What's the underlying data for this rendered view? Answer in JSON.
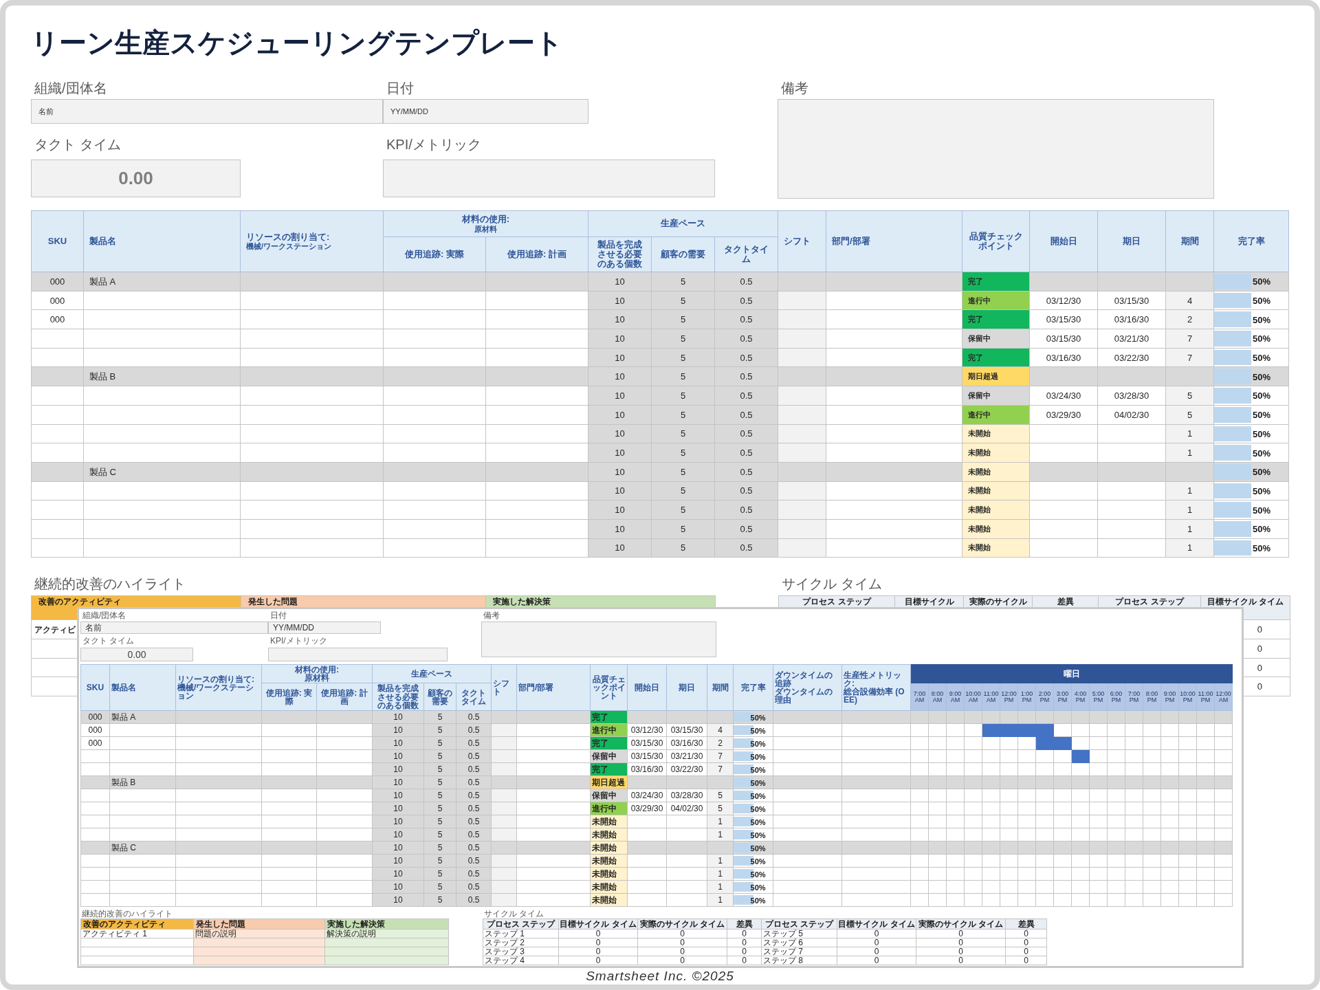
{
  "title": "リーン生産スケジューリングテンプレート",
  "form": {
    "org_label": "組織/団体名",
    "org_value": "名前",
    "date_label": "日付",
    "date_value": "YY/MM/DD",
    "notes_label": "備考",
    "takt_label": "タクト タイム",
    "takt_value": "0.00",
    "kpi_label": "KPI/メトリック"
  },
  "schedule": {
    "columns": [
      {
        "kind": "single",
        "title": "SKU"
      },
      {
        "kind": "single",
        "title": "製品名"
      },
      {
        "kind": "single",
        "title": "リソースの割り当て:",
        "subtitle": "機械/ワークステーション"
      },
      {
        "kind": "group",
        "title": "材料の使用:",
        "subtitle": "原材料",
        "children": [
          "使用追跡: 実際",
          "使用追跡: 計画"
        ]
      },
      {
        "kind": "group",
        "title": "生産ペース",
        "children": [
          "製品を完成させる必要のある個数",
          "顧客の需要",
          "タクトタイム"
        ]
      },
      {
        "kind": "single",
        "title": "シフト"
      },
      {
        "kind": "single",
        "title": "部門/部署"
      },
      {
        "kind": "single",
        "title": "品質チェックポイント"
      },
      {
        "kind": "single",
        "title": "開始日"
      },
      {
        "kind": "single",
        "title": "期日"
      },
      {
        "kind": "single",
        "title": "期間"
      },
      {
        "kind": "single",
        "title": "完了率"
      }
    ],
    "rows": [
      {
        "group": true,
        "sku": "000",
        "product": "製品 A",
        "produce": "10",
        "demand": "5",
        "takt": "0.5",
        "status": {
          "label": "完了",
          "kind": "done"
        },
        "completion": "50%",
        "level": 0.5
      },
      {
        "group": false,
        "sku": "000",
        "produce": "10",
        "demand": "5",
        "takt": "0.5",
        "status": {
          "label": "進行中",
          "kind": "progress"
        },
        "start": "03/12/30",
        "due": "03/15/30",
        "duration": "4",
        "completion": "50%",
        "level": 0.5
      },
      {
        "group": false,
        "sku": "000",
        "produce": "10",
        "demand": "5",
        "takt": "0.5",
        "status": {
          "label": "完了",
          "kind": "done"
        },
        "start": "03/15/30",
        "due": "03/16/30",
        "duration": "2",
        "completion": "50%",
        "level": 0.5
      },
      {
        "group": false,
        "produce": "10",
        "demand": "5",
        "takt": "0.5",
        "status": {
          "label": "保留中",
          "kind": "hold"
        },
        "start": "03/15/30",
        "due": "03/21/30",
        "duration": "7",
        "completion": "50%",
        "level": 0.5
      },
      {
        "group": false,
        "produce": "10",
        "demand": "5",
        "takt": "0.5",
        "status": {
          "label": "完了",
          "kind": "done"
        },
        "start": "03/16/30",
        "due": "03/22/30",
        "duration": "7",
        "completion": "50%",
        "level": 0.5
      },
      {
        "group": true,
        "product": "製品 B",
        "produce": "10",
        "demand": "5",
        "takt": "0.5",
        "status": {
          "label": "期日超過",
          "kind": "overdue"
        },
        "completion": "50%",
        "level": 0.5
      },
      {
        "group": false,
        "produce": "10",
        "demand": "5",
        "takt": "0.5",
        "status": {
          "label": "保留中",
          "kind": "hold"
        },
        "start": "03/24/30",
        "due": "03/28/30",
        "duration": "5",
        "completion": "50%",
        "level": 0.5
      },
      {
        "group": false,
        "produce": "10",
        "demand": "5",
        "takt": "0.5",
        "status": {
          "label": "進行中",
          "kind": "progress"
        },
        "start": "03/29/30",
        "due": "04/02/30",
        "duration": "5",
        "completion": "50%",
        "level": 0.5
      },
      {
        "group": false,
        "produce": "10",
        "demand": "5",
        "takt": "0.5",
        "status": {
          "label": "未開始",
          "kind": "not_started"
        },
        "duration": "1",
        "completion": "50%",
        "level": 0.5
      },
      {
        "group": false,
        "produce": "10",
        "demand": "5",
        "takt": "0.5",
        "status": {
          "label": "未開始",
          "kind": "not_started"
        },
        "duration": "1",
        "completion": "50%",
        "level": 0.5
      },
      {
        "group": true,
        "product": "製品 C",
        "produce": "10",
        "demand": "5",
        "takt": "0.5",
        "status": {
          "label": "未開始",
          "kind": "not_started"
        },
        "completion": "50%",
        "level": 0.5
      },
      {
        "group": false,
        "produce": "10",
        "demand": "5",
        "takt": "0.5",
        "status": {
          "label": "未開始",
          "kind": "not_started"
        },
        "duration": "1",
        "completion": "50%",
        "level": 0.5
      },
      {
        "group": false,
        "produce": "10",
        "demand": "5",
        "takt": "0.5",
        "status": {
          "label": "未開始",
          "kind": "not_started"
        },
        "duration": "1",
        "completion": "50%",
        "level": 0.5
      },
      {
        "group": false,
        "produce": "10",
        "demand": "5",
        "takt": "0.5",
        "status": {
          "label": "未開始",
          "kind": "not_started"
        },
        "duration": "1",
        "completion": "50%",
        "level": 0.5
      },
      {
        "group": false,
        "produce": "10",
        "demand": "5",
        "takt": "0.5",
        "status": {
          "label": "未開始",
          "kind": "not_started"
        },
        "duration": "1",
        "completion": "50%",
        "level": 0.5
      }
    ]
  },
  "improvement": {
    "title": "継続的改善のハイライト",
    "headers": [
      {
        "label": "改善のアクティビティ",
        "color": "#f4b942"
      },
      {
        "label": "発生した問題",
        "color": "#f8cbad"
      },
      {
        "label": "実施した解決策",
        "color": "#c6e0b4"
      }
    ],
    "rows": [
      {
        "activity": "アクティビ"
      },
      {},
      {},
      {}
    ]
  },
  "cycle": {
    "title": "サイクル タイム",
    "headers": [
      "プロセス ステップ",
      "目標サイクル",
      "実際のサイクル",
      "差異",
      "プロセス ステップ",
      "目標サイクル タイム"
    ],
    "rows": [
      {
        "last": "0"
      },
      {
        "last": "0"
      },
      {
        "last": "0"
      },
      {
        "last": "0"
      }
    ]
  },
  "inset": {
    "form": {
      "org_label": "組織/団体名",
      "org_value": "名前",
      "date_label": "日付",
      "date_value": "YY/MM/DD",
      "notes_label": "備考",
      "takt_label": "タクト タイム",
      "takt_value": "0.00",
      "kpi_label": "KPI/メトリック"
    },
    "schedule": {
      "columns": [
        {
          "kind": "single",
          "title": "SKU"
        },
        {
          "kind": "single",
          "title": "製品名"
        },
        {
          "kind": "single",
          "title": "リソースの割り当て:",
          "subtitle": "機械/ワークステーション"
        },
        {
          "kind": "group",
          "title": "材料の使用:",
          "subtitle": "原材料",
          "children": [
            "使用追跡: 実際",
            "使用追跡: 計画"
          ]
        },
        {
          "kind": "group",
          "title": "生産ペース",
          "children": [
            "製品を完成させる必要のある個数",
            "顧客の需要",
            "タクトタイム"
          ]
        },
        {
          "kind": "single",
          "title": "シフト"
        },
        {
          "kind": "single",
          "title": "部門/部署"
        },
        {
          "kind": "single",
          "title": "品質チェックポイント"
        },
        {
          "kind": "single",
          "title": "開始日"
        },
        {
          "kind": "single",
          "title": "期日"
        },
        {
          "kind": "single",
          "title": "期間"
        },
        {
          "kind": "single",
          "title": "完了率"
        },
        {
          "kind": "single",
          "title": "ダウンタイムの追跡",
          "subtitle": "ダウンタイムの理由"
        },
        {
          "kind": "single",
          "title": "生産性メトリック:",
          "subtitle": "総合設備効率 (OEE)"
        },
        {
          "kind": "timeline",
          "title": "曜日",
          "children": [
            "7:00 AM",
            "8:00 AM",
            "9:00 AM",
            "10:00 AM",
            "11:00 AM",
            "12:00 PM",
            "1:00 PM",
            "2:00 PM",
            "3:00 PM",
            "4:00 PM",
            "5:00 PM",
            "6:00 PM",
            "7:00 PM",
            "8:00 PM",
            "9:00 PM",
            "10:00 PM",
            "11:00 PM",
            "12:00 AM"
          ]
        }
      ],
      "rows": [
        {
          "group": true,
          "sku": "000",
          "product": "製品 A",
          "produce": "10",
          "demand": "5",
          "takt": "0.5",
          "status": {
            "label": "完了",
            "kind": "done"
          },
          "completion": "50%",
          "level": 0.5,
          "slots": [
            false,
            false,
            false,
            false,
            false,
            false,
            false,
            false,
            false,
            false,
            false,
            false,
            false,
            false,
            false,
            false,
            false,
            false
          ]
        },
        {
          "group": false,
          "sku": "000",
          "produce": "10",
          "demand": "5",
          "takt": "0.5",
          "status": {
            "label": "進行中",
            "kind": "progress"
          },
          "start": "03/12/30",
          "due": "03/15/30",
          "duration": "4",
          "completion": "50%",
          "level": 0.5,
          "slots": [
            false,
            false,
            false,
            false,
            true,
            true,
            true,
            true,
            false,
            false,
            false,
            false,
            false,
            false,
            false,
            false,
            false,
            false
          ]
        },
        {
          "group": false,
          "sku": "000",
          "produce": "10",
          "demand": "5",
          "takt": "0.5",
          "status": {
            "label": "完了",
            "kind": "done"
          },
          "start": "03/15/30",
          "due": "03/16/30",
          "duration": "2",
          "completion": "50%",
          "level": 0.5,
          "slots": [
            false,
            false,
            false,
            false,
            false,
            false,
            false,
            true,
            true,
            false,
            false,
            false,
            false,
            false,
            false,
            false,
            false,
            false
          ]
        },
        {
          "group": false,
          "produce": "10",
          "demand": "5",
          "takt": "0.5",
          "status": {
            "label": "保留中",
            "kind": "hold"
          },
          "start": "03/15/30",
          "due": "03/21/30",
          "duration": "7",
          "completion": "50%",
          "level": 0.5,
          "slots": [
            false,
            false,
            false,
            false,
            false,
            false,
            false,
            false,
            false,
            true,
            false,
            false,
            false,
            false,
            false,
            false,
            false,
            false
          ]
        },
        {
          "group": false,
          "produce": "10",
          "demand": "5",
          "takt": "0.5",
          "status": {
            "label": "完了",
            "kind": "done"
          },
          "start": "03/16/30",
          "due": "03/22/30",
          "duration": "7",
          "completion": "50%",
          "level": 0.5,
          "slots": [
            false,
            false,
            false,
            false,
            false,
            false,
            false,
            false,
            false,
            false,
            false,
            false,
            false,
            false,
            false,
            false,
            false,
            false
          ]
        },
        {
          "group": true,
          "product": "製品 B",
          "produce": "10",
          "demand": "5",
          "takt": "0.5",
          "status": {
            "label": "期日超過",
            "kind": "overdue"
          },
          "completion": "50%",
          "level": 0.5,
          "slots": [
            false,
            false,
            false,
            false,
            false,
            false,
            false,
            false,
            false,
            false,
            false,
            false,
            false,
            false,
            false,
            false,
            false,
            false
          ]
        },
        {
          "group": false,
          "produce": "10",
          "demand": "5",
          "takt": "0.5",
          "status": {
            "label": "保留中",
            "kind": "hold"
          },
          "start": "03/24/30",
          "due": "03/28/30",
          "duration": "5",
          "completion": "50%",
          "level": 0.5,
          "slots": [
            false,
            false,
            false,
            false,
            false,
            false,
            false,
            false,
            false,
            false,
            false,
            false,
            false,
            false,
            false,
            false,
            false,
            false
          ]
        },
        {
          "group": false,
          "produce": "10",
          "demand": "5",
          "takt": "0.5",
          "status": {
            "label": "進行中",
            "kind": "progress"
          },
          "start": "03/29/30",
          "due": "04/02/30",
          "duration": "5",
          "completion": "50%",
          "level": 0.5,
          "slots": [
            false,
            false,
            false,
            false,
            false,
            false,
            false,
            false,
            false,
            false,
            false,
            false,
            false,
            false,
            false,
            false,
            false,
            false
          ]
        },
        {
          "group": false,
          "produce": "10",
          "demand": "5",
          "takt": "0.5",
          "status": {
            "label": "未開始",
            "kind": "not_started"
          },
          "duration": "1",
          "completion": "50%",
          "level": 0.5,
          "slots": [
            false,
            false,
            false,
            false,
            false,
            false,
            false,
            false,
            false,
            false,
            false,
            false,
            false,
            false,
            false,
            false,
            false,
            false
          ]
        },
        {
          "group": false,
          "produce": "10",
          "demand": "5",
          "takt": "0.5",
          "status": {
            "label": "未開始",
            "kind": "not_started"
          },
          "duration": "1",
          "completion": "50%",
          "level": 0.5,
          "slots": [
            false,
            false,
            false,
            false,
            false,
            false,
            false,
            false,
            false,
            false,
            false,
            false,
            false,
            false,
            false,
            false,
            false,
            false
          ]
        },
        {
          "group": true,
          "product": "製品 C",
          "produce": "10",
          "demand": "5",
          "takt": "0.5",
          "status": {
            "label": "未開始",
            "kind": "not_started"
          },
          "completion": "50%",
          "level": 0.5,
          "slots": [
            false,
            false,
            false,
            false,
            false,
            false,
            false,
            false,
            false,
            false,
            false,
            false,
            false,
            false,
            false,
            false,
            false,
            false
          ]
        },
        {
          "group": false,
          "produce": "10",
          "demand": "5",
          "takt": "0.5",
          "status": {
            "label": "未開始",
            "kind": "not_started"
          },
          "duration": "1",
          "completion": "50%",
          "level": 0.5,
          "slots": [
            false,
            false,
            false,
            false,
            false,
            false,
            false,
            false,
            false,
            false,
            false,
            false,
            false,
            false,
            false,
            false,
            false,
            false
          ]
        },
        {
          "group": false,
          "produce": "10",
          "demand": "5",
          "takt": "0.5",
          "status": {
            "label": "未開始",
            "kind": "not_started"
          },
          "duration": "1",
          "completion": "50%",
          "level": 0.5,
          "slots": [
            false,
            false,
            false,
            false,
            false,
            false,
            false,
            false,
            false,
            false,
            false,
            false,
            false,
            false,
            false,
            false,
            false,
            false
          ]
        },
        {
          "group": false,
          "produce": "10",
          "demand": "5",
          "takt": "0.5",
          "status": {
            "label": "未開始",
            "kind": "not_started"
          },
          "duration": "1",
          "completion": "50%",
          "level": 0.5,
          "slots": [
            false,
            false,
            false,
            false,
            false,
            false,
            false,
            false,
            false,
            false,
            false,
            false,
            false,
            false,
            false,
            false,
            false,
            false
          ]
        },
        {
          "group": false,
          "produce": "10",
          "demand": "5",
          "takt": "0.5",
          "status": {
            "label": "未開始",
            "kind": "not_started"
          },
          "duration": "1",
          "completion": "50%",
          "level": 0.5,
          "slots": [
            false,
            false,
            false,
            false,
            false,
            false,
            false,
            false,
            false,
            false,
            false,
            false,
            false,
            false,
            false,
            false,
            false,
            false
          ]
        }
      ]
    },
    "improvement": {
      "title": "継続的改善のハイライト",
      "headers": [
        {
          "label": "改善のアクティビティ",
          "color": "#f4b942"
        },
        {
          "label": "発生した問題",
          "color": "#f8cbad"
        },
        {
          "label": "実施した解決策",
          "color": "#c6e0b4"
        }
      ],
      "rows": [
        {
          "activity": "アクティビティ 1",
          "issue": "問題の説明",
          "solution": "解決策の説明"
        },
        {},
        {},
        {}
      ]
    },
    "cycle": {
      "title": "サイクル タイム",
      "headers": [
        "プロセス ステップ",
        "目標サイクル タイム",
        "実際のサイクル タイム",
        "差異",
        "プロセス ステップ",
        "目標サイクル タイム",
        "実際のサイクル タイム",
        "差異"
      ],
      "rows": [
        {
          "cells": [
            "ステップ 1",
            "0",
            "0",
            "0",
            "ステップ 5",
            "0",
            "0",
            "0"
          ]
        },
        {
          "cells": [
            "ステップ 2",
            "0",
            "0",
            "0",
            "ステップ 6",
            "0",
            "0",
            "0"
          ]
        },
        {
          "cells": [
            "ステップ 3",
            "0",
            "0",
            "0",
            "ステップ 7",
            "0",
            "0",
            "0"
          ]
        },
        {
          "cells": [
            "ステップ 4",
            "0",
            "0",
            "0",
            "ステップ 8",
            "0",
            "0",
            "0"
          ]
        }
      ]
    }
  },
  "footer": "Smartsheet Inc. ©2025"
}
